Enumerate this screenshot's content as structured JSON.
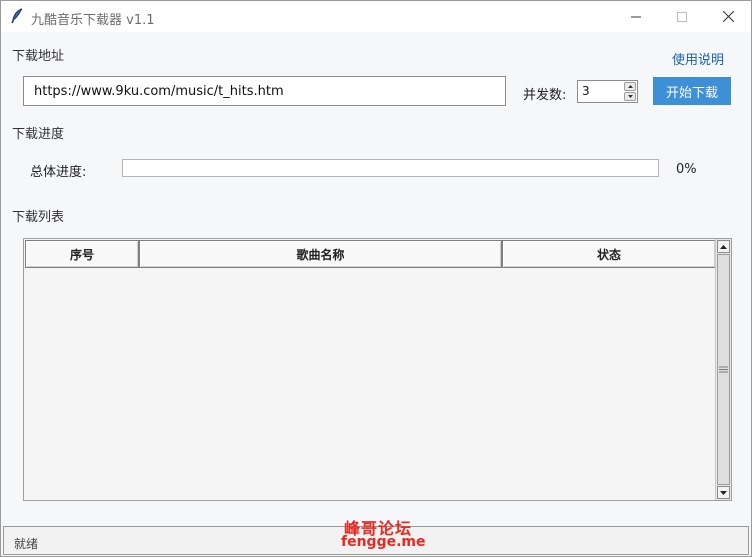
{
  "window": {
    "title": "九酷音乐下载器 v1.1",
    "icon": "feather-icon"
  },
  "download_address": {
    "section_label": "下载地址",
    "help_link": "使用说明",
    "url_value": "https://www.9ku.com/music/t_hits.htm",
    "concurrency_label": "并发数:",
    "concurrency_value": "3",
    "start_button": "开始下载"
  },
  "progress": {
    "section_label": "下载进度",
    "total_label": "总体进度:",
    "percent_text": "0%",
    "percent_value": 0
  },
  "download_list": {
    "section_label": "下载列表",
    "columns": [
      "序号",
      "歌曲名称",
      "状态"
    ],
    "rows": []
  },
  "status_bar": {
    "text": "就绪"
  },
  "watermark": {
    "line1": "峰哥论坛",
    "line2": "fengge.me"
  },
  "colors": {
    "accent": "#3d8fd6",
    "link": "#1a5fb4",
    "watermark": "#e8291f"
  }
}
